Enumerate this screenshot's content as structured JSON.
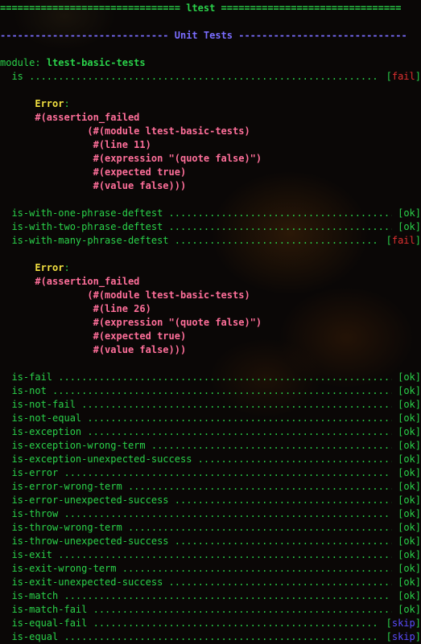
{
  "header": {
    "title": "ltest",
    "subtitle": "Unit Tests"
  },
  "module": {
    "prefix": "module:",
    "name": "ltest-basic-tests"
  },
  "lines": [
    {
      "t": "title"
    },
    {
      "t": "blank"
    },
    {
      "t": "subtitle"
    },
    {
      "t": "blank"
    },
    {
      "t": "module"
    },
    {
      "t": "test",
      "name": "is",
      "status": "fail"
    },
    {
      "t": "blank"
    },
    {
      "t": "errorhead",
      "text": "Error"
    },
    {
      "t": "err",
      "text": "#(assertion_failed"
    },
    {
      "t": "err",
      "text": "         (#(module ltest-basic-tests)"
    },
    {
      "t": "err",
      "text": "          #(line 11)"
    },
    {
      "t": "err",
      "text": "          #(expression \"(quote false)\")"
    },
    {
      "t": "err",
      "text": "          #(expected true)"
    },
    {
      "t": "err",
      "text": "          #(value false)))"
    },
    {
      "t": "blank"
    },
    {
      "t": "test",
      "name": "is-with-one-phrase-deftest",
      "status": "ok"
    },
    {
      "t": "test",
      "name": "is-with-two-phrase-deftest",
      "status": "ok"
    },
    {
      "t": "test",
      "name": "is-with-many-phrase-deftest",
      "status": "fail"
    },
    {
      "t": "blank"
    },
    {
      "t": "errorhead",
      "text": "Error"
    },
    {
      "t": "err",
      "text": "#(assertion_failed"
    },
    {
      "t": "err",
      "text": "         (#(module ltest-basic-tests)"
    },
    {
      "t": "err",
      "text": "          #(line 26)"
    },
    {
      "t": "err",
      "text": "          #(expression \"(quote false)\")"
    },
    {
      "t": "err",
      "text": "          #(expected true)"
    },
    {
      "t": "err",
      "text": "          #(value false)))"
    },
    {
      "t": "blank"
    },
    {
      "t": "test",
      "name": "is-fail",
      "status": "ok"
    },
    {
      "t": "test",
      "name": "is-not",
      "status": "ok"
    },
    {
      "t": "test",
      "name": "is-not-fail",
      "status": "ok"
    },
    {
      "t": "test",
      "name": "is-not-equal",
      "status": "ok"
    },
    {
      "t": "test",
      "name": "is-exception",
      "status": "ok"
    },
    {
      "t": "test",
      "name": "is-exception-wrong-term",
      "status": "ok"
    },
    {
      "t": "test",
      "name": "is-exception-unexpected-success",
      "status": "ok"
    },
    {
      "t": "test",
      "name": "is-error",
      "status": "ok"
    },
    {
      "t": "test",
      "name": "is-error-wrong-term",
      "status": "ok"
    },
    {
      "t": "test",
      "name": "is-error-unexpected-success",
      "status": "ok"
    },
    {
      "t": "test",
      "name": "is-throw",
      "status": "ok"
    },
    {
      "t": "test",
      "name": "is-throw-wrong-term",
      "status": "ok"
    },
    {
      "t": "test",
      "name": "is-throw-unexpected-success",
      "status": "ok"
    },
    {
      "t": "test",
      "name": "is-exit",
      "status": "ok"
    },
    {
      "t": "test",
      "name": "is-exit-wrong-term",
      "status": "ok"
    },
    {
      "t": "test",
      "name": "is-exit-unexpected-success",
      "status": "ok"
    },
    {
      "t": "test",
      "name": "is-match",
      "status": "ok"
    },
    {
      "t": "test",
      "name": "is-match-fail",
      "status": "ok"
    },
    {
      "t": "test",
      "name": "is-equal-fail",
      "status": "skip"
    },
    {
      "t": "test",
      "name": "is-equal",
      "status": "skip"
    }
  ],
  "colors": {
    "ok": "#2ad24a",
    "fail": "#e03030",
    "skip": "#5a4dff",
    "error_heading": "#f2e040",
    "error_body": "#ff6f9a",
    "subtitle": "#7a6dff",
    "background": "#0a0706"
  }
}
